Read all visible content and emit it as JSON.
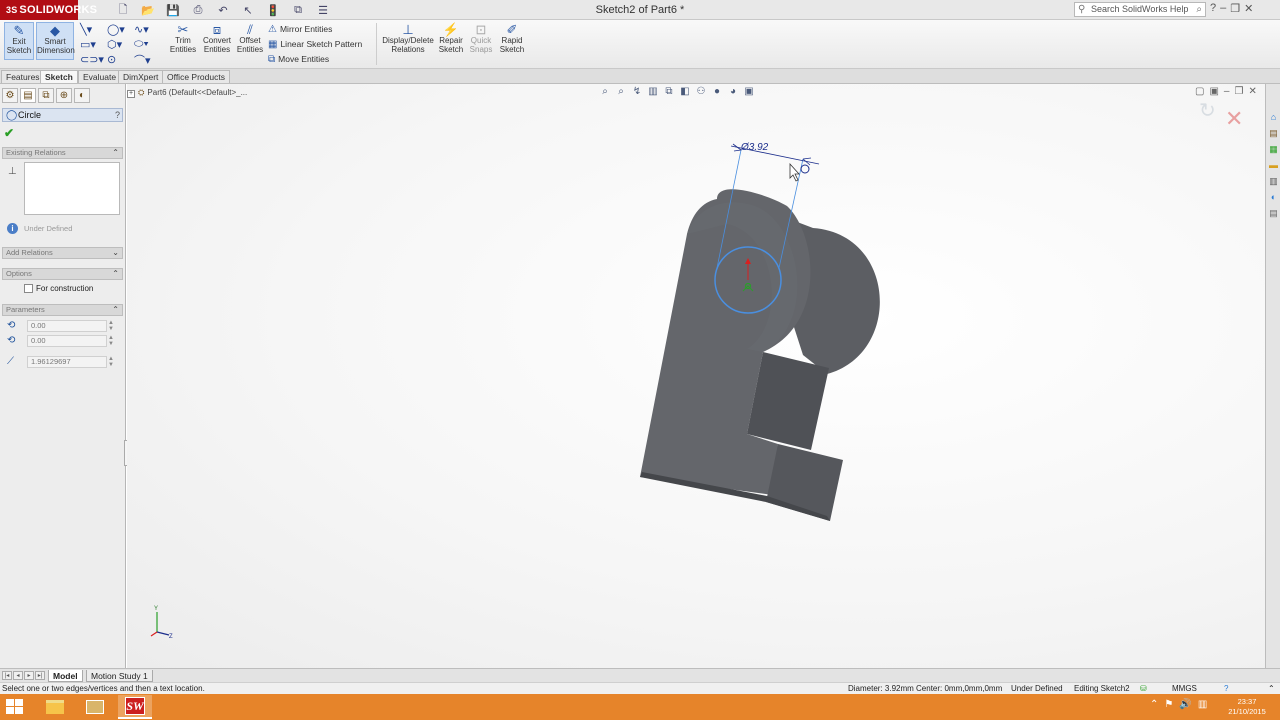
{
  "app": {
    "logo_text": "SOLIDWORKS",
    "logo_mark": "3S",
    "document_title": "Sketch2 of Part6 *",
    "help_search_placeholder": "Search SolidWorks Help"
  },
  "ribbon": {
    "exit_sketch": [
      "Exit",
      "Sketch"
    ],
    "smart_dimension": [
      "Smart",
      "Dimension"
    ],
    "trim_entities": [
      "Trim",
      "Entities"
    ],
    "convert_entities": [
      "Convert",
      "Entities"
    ],
    "offset_entities": [
      "Offset",
      "Entities"
    ],
    "mirror_entities": "Mirror Entities",
    "linear_sketch_pattern": "Linear Sketch Pattern",
    "move_entities": "Move Entities",
    "display_delete_relations": [
      "Display/Delete",
      "Relations"
    ],
    "repair_sketch": [
      "Repair",
      "Sketch"
    ],
    "quick_snaps": [
      "Quick",
      "Snaps"
    ],
    "rapid_sketch": [
      "Rapid",
      "Sketch"
    ]
  },
  "tabs": [
    "Features",
    "Sketch",
    "Evaluate",
    "DimXpert",
    "Office Products"
  ],
  "active_tab": "Sketch",
  "property_manager": {
    "title": "Circle",
    "existing_relations_header": "Existing Relations",
    "status": "Under Defined",
    "add_relations_header": "Add Relations",
    "options_header": "Options",
    "for_construction_label": "For construction",
    "parameters_header": "Parameters",
    "center_x": "0.00",
    "center_y": "0.00",
    "radius": "1.96129697"
  },
  "graphics": {
    "tree_crumb": "Part6  (Default<<Default>_...",
    "dimension_text": "Ø3.92",
    "triad_y_label": "Y",
    "triad_z_label": "Z"
  },
  "bottom_tabs": [
    "Model",
    "Motion Study 1"
  ],
  "active_bottom_tab": "Model",
  "status_bar": {
    "prompt": "Select one or two edges/vertices and then a text location.",
    "diameter": "Diameter: 3.92mm  Center: 0mm,0mm,0mm",
    "defined_state": "Under Defined",
    "editing": "Editing Sketch2",
    "units": "MMGS"
  },
  "taskbar": {
    "time": "23:37",
    "date": "21/10/2015"
  },
  "colors": {
    "brand_red": "#b10d14",
    "taskbar_orange": "#e6842a",
    "sketch_blue": "#4a8fe0",
    "model_gray": "#5b5d62"
  }
}
